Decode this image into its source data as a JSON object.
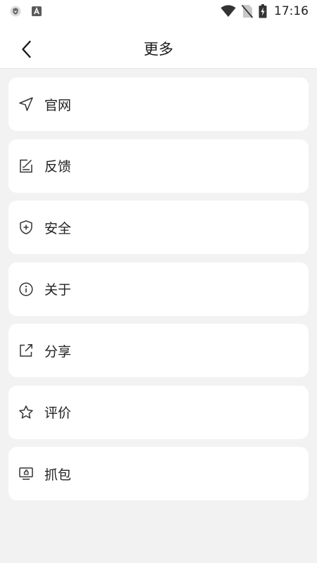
{
  "status_bar": {
    "time": "17:16",
    "left_icons": [
      "shield-notification-icon",
      "a-notification-icon"
    ],
    "right_icons": [
      "wifi-icon",
      "no-sim-icon",
      "battery-charging-icon"
    ]
  },
  "header": {
    "title": "更多",
    "back_icon": "chevron-left-icon"
  },
  "menu": {
    "items": [
      {
        "label": "官网",
        "icon": "navigation-arrow-icon"
      },
      {
        "label": "反馈",
        "icon": "edit-note-icon"
      },
      {
        "label": "安全",
        "icon": "shield-plus-icon"
      },
      {
        "label": "关于",
        "icon": "info-circle-icon"
      },
      {
        "label": "分享",
        "icon": "share-box-icon"
      },
      {
        "label": "评价",
        "icon": "star-icon"
      },
      {
        "label": "抓包",
        "icon": "monitor-capture-icon"
      }
    ]
  },
  "colors": {
    "background": "#f2f2f3",
    "card": "#ffffff",
    "text": "#222222",
    "icon": "#333333"
  }
}
